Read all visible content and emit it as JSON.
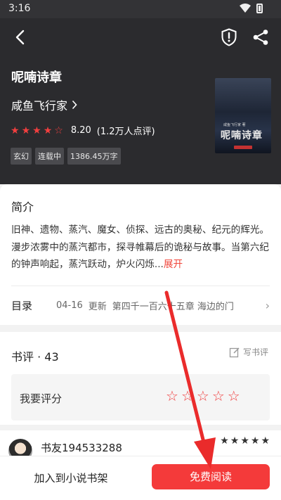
{
  "status_bar": {
    "time": "3:16"
  },
  "book": {
    "title": "呢喃诗章",
    "author": "咸鱼飞行家",
    "rating": {
      "score": "8.20",
      "count": "(1.2万人点评)",
      "stars_filled": 4,
      "stars_total": 5
    },
    "tags": [
      "玄幻",
      "连载中",
      "1386.45万字"
    ],
    "cover": {
      "title": "呢喃诗章",
      "author_line": "咸鱼飞行家 著"
    }
  },
  "intro": {
    "section_title": "简介",
    "text": "旧神、遗物、蒸汽、魔女、侦探、远古的奥秘、纪元的辉光。漫步浓雾中的蒸汽都市，探寻帷幕后的诡秘与故事。当第六纪的钟声响起，蒸汽跃动，炉火闪烁...",
    "expand_label": "展开"
  },
  "toc": {
    "label": "目录",
    "date": "04-16",
    "update_label": "更新",
    "chapter": "第四千一百六十五章 海边的门"
  },
  "reviews": {
    "title": "书评 · 43",
    "write_label": "写书评",
    "rate_prompt": "我要评分",
    "first_review": {
      "user": "书友194533288"
    }
  },
  "bottom_bar": {
    "add_shelf_label": "加入到小说书架",
    "read_label": "免费阅读"
  },
  "colors": {
    "accent": "#f43a3a",
    "header_bg": "#2b2b2e"
  }
}
